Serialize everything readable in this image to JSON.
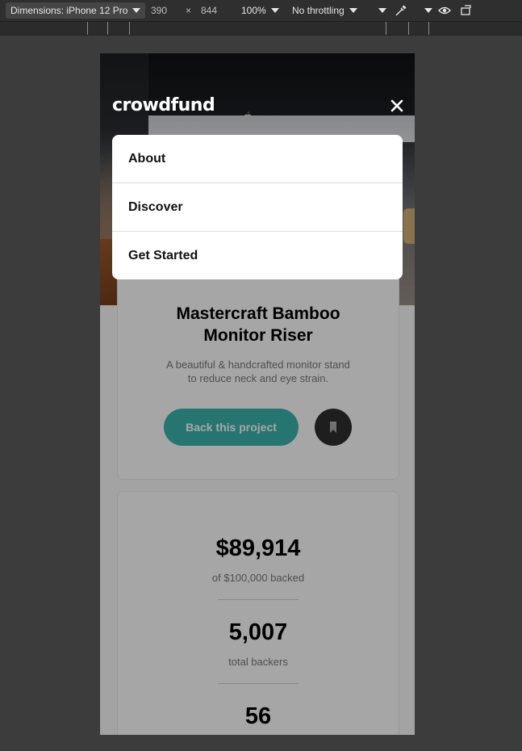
{
  "devtools": {
    "dimensions_label": "Dimensions: iPhone 12 Pro",
    "width": "390",
    "times": "×",
    "height": "844",
    "zoom": "100%",
    "throttling": "No throttling"
  },
  "header": {
    "logo_text": "crowdfund",
    "close_icon": "close-icon"
  },
  "menu": {
    "items": [
      {
        "label": "About"
      },
      {
        "label": "Discover"
      },
      {
        "label": "Get Started"
      }
    ]
  },
  "project": {
    "title_line1": "Mastercraft Bamboo",
    "title_line2": "Monitor Riser",
    "description_line1": "A beautiful & handcrafted monitor stand",
    "description_line2": "to reduce neck and eye strain.",
    "back_label": "Back this project"
  },
  "stats": {
    "backed_amount": "$89,914",
    "backed_label": "of $100,000 backed",
    "backers": "5,007",
    "backers_label": "total backers",
    "days_left": "56"
  },
  "colors": {
    "accent": "#3cb4ac",
    "dark": "#2f2f2f"
  }
}
